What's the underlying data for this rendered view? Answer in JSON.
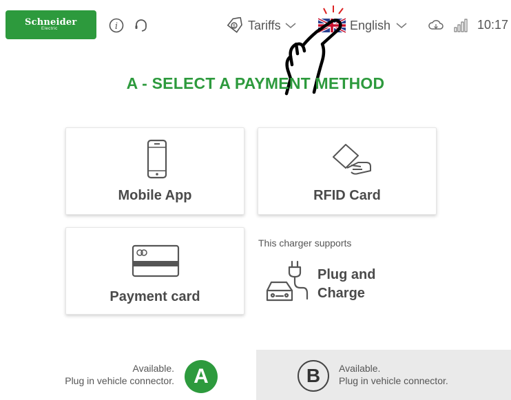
{
  "header": {
    "logo_main": "Schneider",
    "logo_sub": "Electric",
    "tariffs_label": "Tariffs",
    "language_label": "English",
    "time": "10:17"
  },
  "main": {
    "title": "A - SELECT A  PAYMENT METHOD",
    "methods": [
      {
        "label": "Mobile App",
        "icon": "mobile-phone-icon"
      },
      {
        "label": "RFID Card",
        "icon": "rfid-card-icon"
      },
      {
        "label": "Payment card",
        "icon": "payment-card-icon"
      }
    ],
    "supports_text": "This charger supports",
    "plug_charge_line1": "Plug and",
    "plug_charge_line2": "Charge"
  },
  "connectors": {
    "a": {
      "letter": "A",
      "status": "Available.",
      "hint": "Plug in vehicle connector."
    },
    "b": {
      "letter": "B",
      "status": "Available.",
      "hint": "Plug in vehicle connector."
    }
  },
  "colors": {
    "brand_green": "#2d9a3d",
    "connector_b_bg": "#eaeaea"
  }
}
